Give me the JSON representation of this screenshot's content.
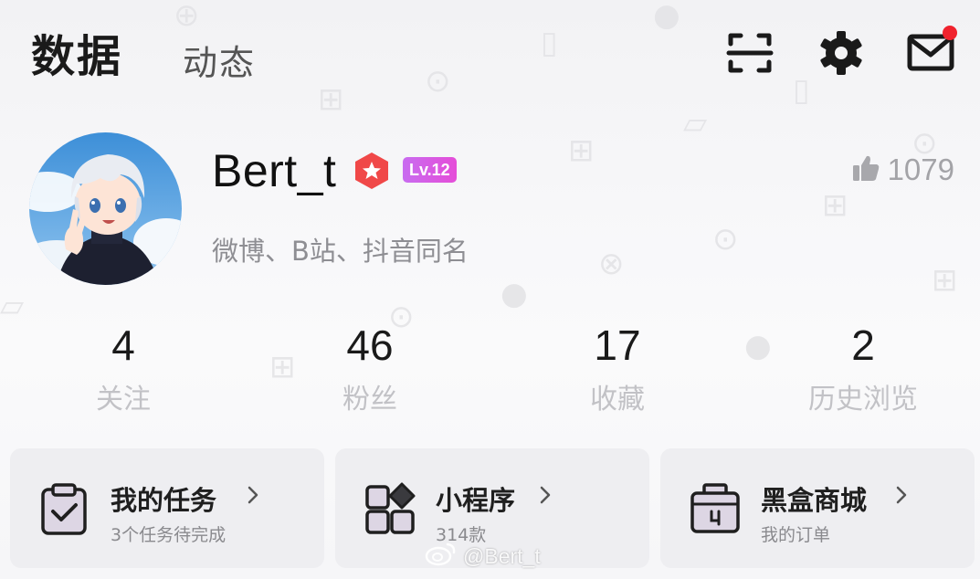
{
  "tabs": {
    "data_label": "数据",
    "feed_label": "动态"
  },
  "header_icons": [
    "scan-icon",
    "gear-icon",
    "mail-icon"
  ],
  "mail_has_notification": true,
  "profile": {
    "username": "Bert_t",
    "level_badge": "Lv.12",
    "likes_count": "1079",
    "bio": "微博、B站、抖音同名"
  },
  "stats": [
    {
      "value": "4",
      "label": "关注"
    },
    {
      "value": "46",
      "label": "粉丝"
    },
    {
      "value": "17",
      "label": "收藏"
    },
    {
      "value": "2",
      "label": "历史浏览"
    }
  ],
  "cards": [
    {
      "title": "我的任务",
      "subtitle": "3个任务待完成",
      "icon": "clipboard-check-icon"
    },
    {
      "title": "小程序",
      "subtitle": "314款",
      "icon": "mini-apps-icon"
    },
    {
      "title": "黑盒商城",
      "subtitle": "我的订单",
      "icon": "shop-box-icon"
    }
  ],
  "watermark": "@Bert_t",
  "colors": {
    "accent_red": "#f0222d",
    "badge_red": "#f04848",
    "level_badge_gradient": [
      "#c86cf0",
      "#e54dd8"
    ]
  }
}
